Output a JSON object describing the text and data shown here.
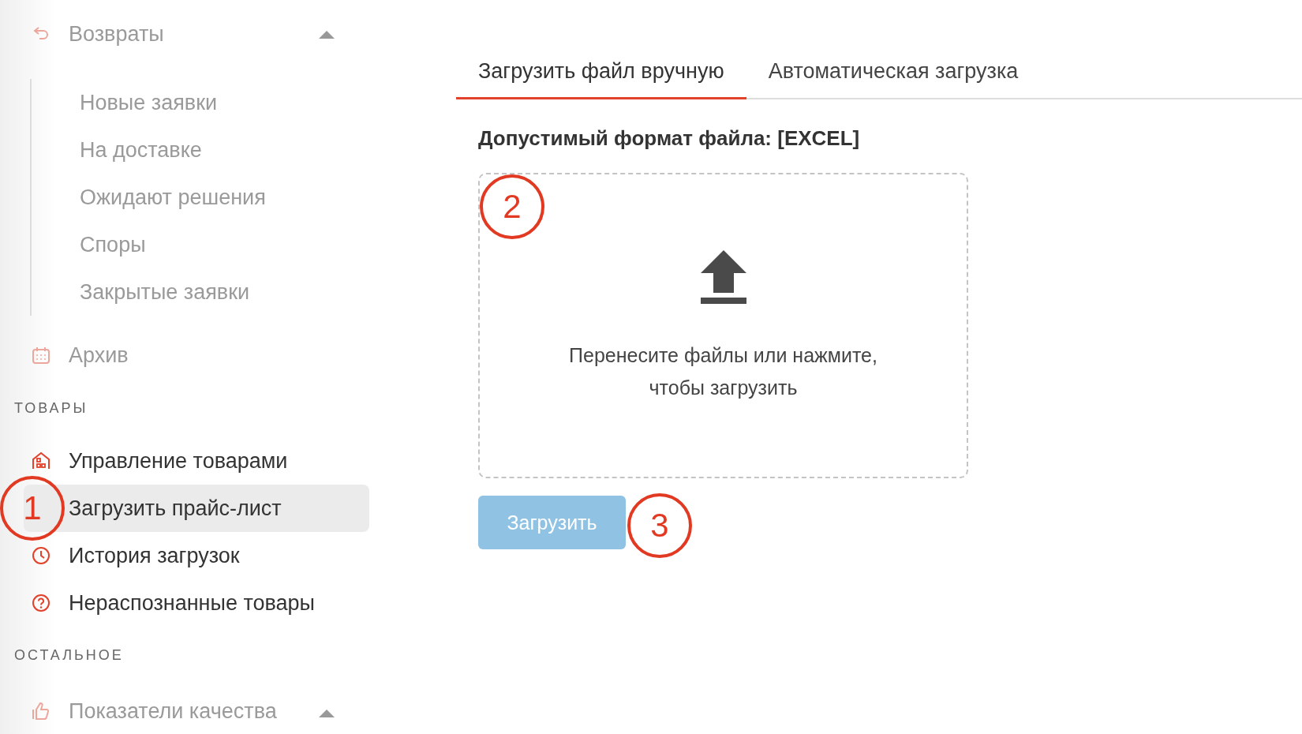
{
  "sidebar": {
    "entries": [
      {
        "kind": "item",
        "label": "Возвраты",
        "dimmed": true,
        "selected": false,
        "expanded": true,
        "children": [
          {
            "label": "Новые заявки",
            "selected": false
          },
          {
            "label": "На доставке",
            "selected": false
          },
          {
            "label": "Ожидают решения",
            "selected": false
          },
          {
            "label": "Споры",
            "selected": false
          },
          {
            "label": "Закрытые заявки",
            "selected": false
          }
        ]
      },
      {
        "kind": "item",
        "label": "Архив",
        "dimmed": true,
        "selected": false
      },
      {
        "kind": "section",
        "label": "ТОВАРЫ"
      },
      {
        "kind": "item",
        "label": "Управление товарами",
        "dimmed": false,
        "selected": false
      },
      {
        "kind": "item",
        "label": "Загрузить прайс-лист",
        "dimmed": false,
        "selected": true,
        "callout": "1"
      },
      {
        "kind": "item",
        "label": "История загрузок",
        "dimmed": false,
        "selected": false
      },
      {
        "kind": "item",
        "label": "Нераспознанные товары",
        "dimmed": false,
        "selected": false
      },
      {
        "kind": "section",
        "label": "ОСТАЛЬНОЕ"
      },
      {
        "kind": "item",
        "label": "Показатели качества",
        "dimmed": true,
        "selected": false,
        "expanded": true
      }
    ]
  },
  "main": {
    "tabs": [
      {
        "label": "Загрузить файл вручную",
        "selected": true
      },
      {
        "label": "Автоматическая загрузка",
        "selected": false
      }
    ],
    "format_note": "Допустимый формат файла: [EXCEL]",
    "dropzone": {
      "text": "Перенесите файлы или нажмите,\nчтобы загрузить",
      "callout": "2"
    },
    "button": {
      "label": "Загрузить",
      "disabled": true,
      "callout": "3"
    }
  }
}
